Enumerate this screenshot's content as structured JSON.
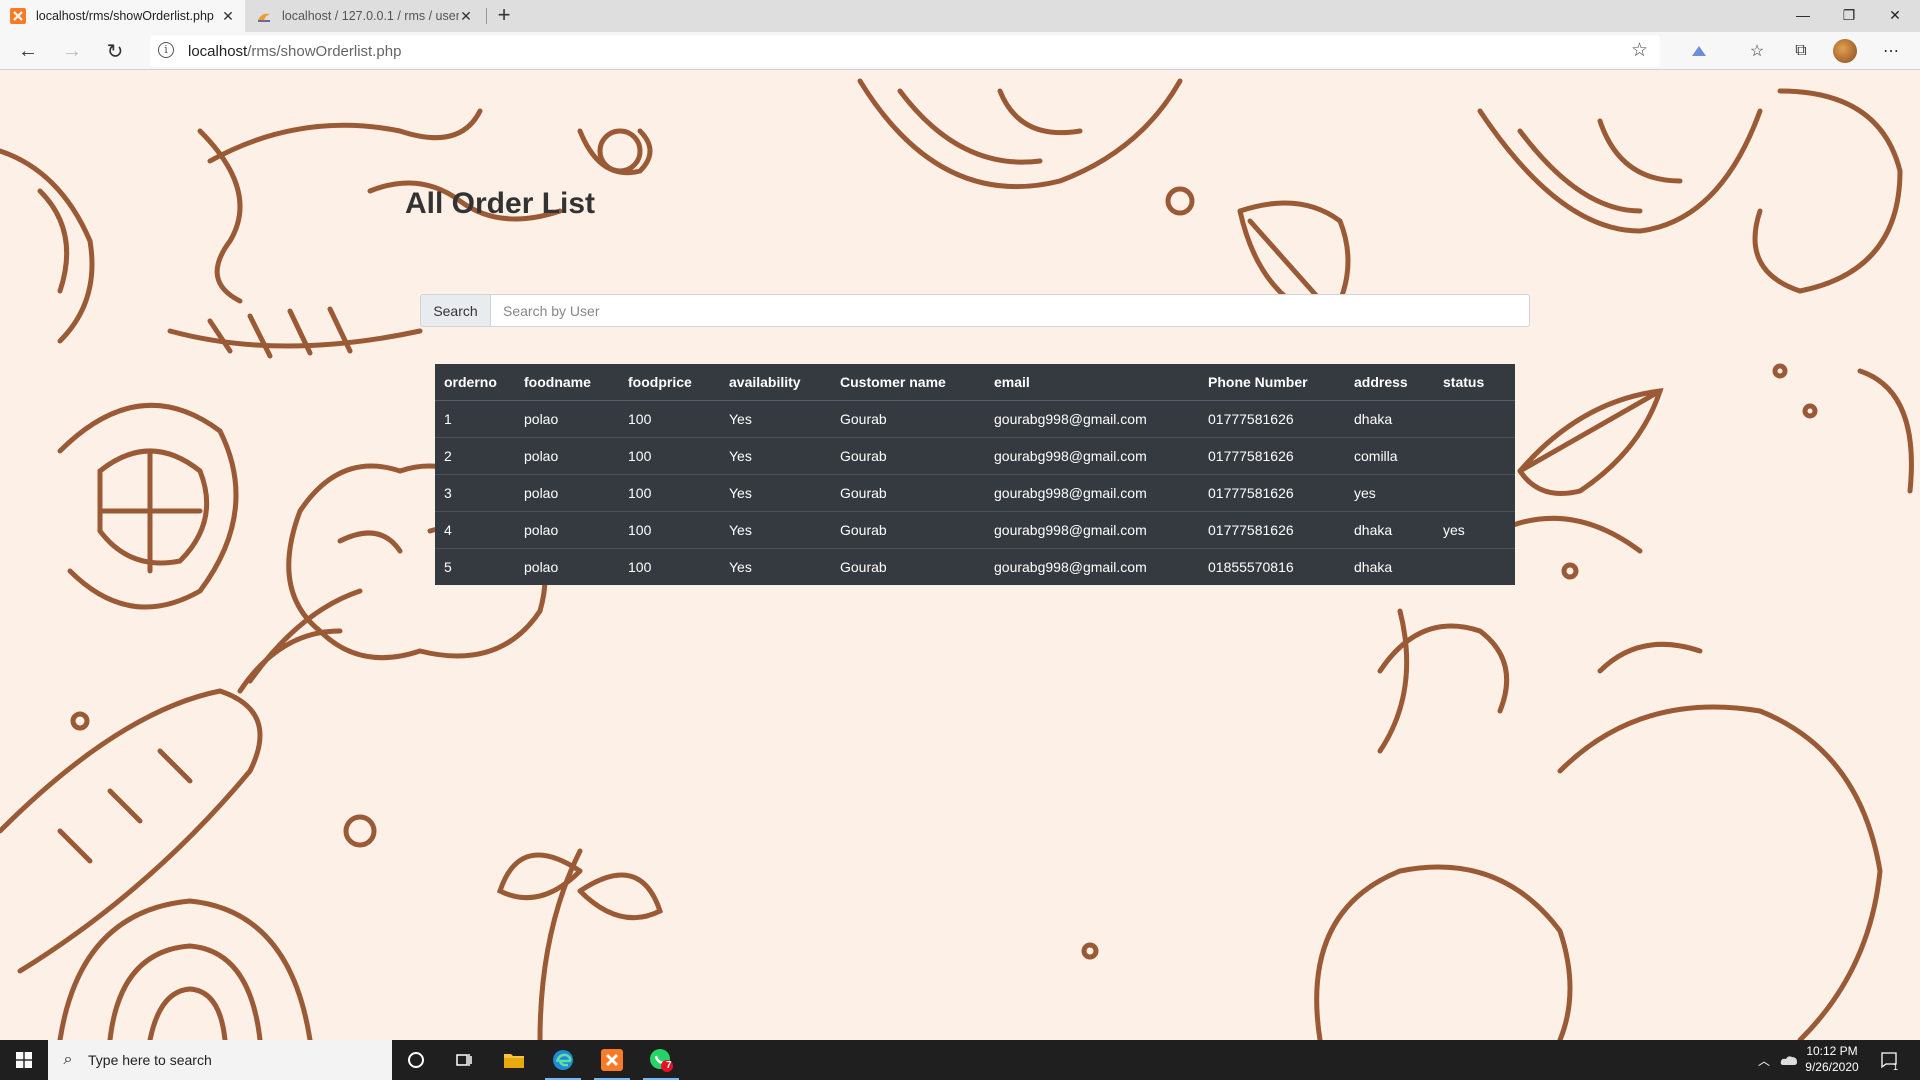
{
  "browser": {
    "tabs": [
      {
        "title": "localhost/rms/showOrderlist.php",
        "active": true
      },
      {
        "title": "localhost / 127.0.0.1 / rms / user",
        "active": false
      }
    ],
    "url_host": "localhost",
    "url_path": "/rms/showOrderlist.php"
  },
  "page": {
    "title": "All Order List",
    "search": {
      "button_label": "Search",
      "placeholder": "Search by User"
    },
    "table": {
      "headers": [
        "orderno",
        "foodname",
        "foodprice",
        "availability",
        "Customer name",
        "email",
        "Phone Number",
        "address",
        "status"
      ],
      "rows": [
        [
          "1",
          "polao",
          "100",
          "Yes",
          "Gourab",
          "gourabg998@gmail.com",
          "01777581626",
          "dhaka",
          ""
        ],
        [
          "2",
          "polao",
          "100",
          "Yes",
          "Gourab",
          "gourabg998@gmail.com",
          "01777581626",
          "comilla",
          ""
        ],
        [
          "3",
          "polao",
          "100",
          "Yes",
          "Gourab",
          "gourabg998@gmail.com",
          "01777581626",
          "yes",
          ""
        ],
        [
          "4",
          "polao",
          "100",
          "Yes",
          "Gourab",
          "gourabg998@gmail.com",
          "01777581626",
          "dhaka",
          "yes"
        ],
        [
          "5",
          "polao",
          "100",
          "Yes",
          "Gourab",
          "gourabg998@gmail.com",
          "01855570816",
          "dhaka",
          ""
        ]
      ]
    }
  },
  "taskbar": {
    "search_placeholder": "Type here to search",
    "time": "10:12 PM",
    "date": "9/26/2020",
    "whatsapp_badge": "7",
    "notification_count": "1"
  },
  "colors": {
    "page_bg": "#fdf0e7",
    "doodle": "#9a5a36",
    "table_bg": "#343a40",
    "xampp_orange": "#fb7a24"
  }
}
